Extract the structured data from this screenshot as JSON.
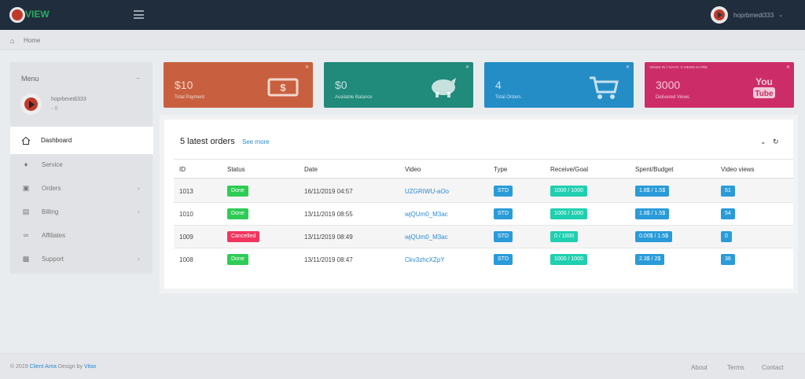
{
  "header": {
    "logo_text": "VIEW",
    "username": "hoprbmedi333"
  },
  "breadcrumb": {
    "home": "Home"
  },
  "sidebar": {
    "menu_label": "Menu",
    "username": "hoprbmedi333",
    "user_sub": "0",
    "items": [
      {
        "label": "Dashboard",
        "icon": "home-icon",
        "active": true
      },
      {
        "label": "Service",
        "icon": "tag-icon",
        "chevron": false
      },
      {
        "label": "Orders",
        "icon": "cart-icon",
        "chevron": true
      },
      {
        "label": "Billing",
        "icon": "card-icon",
        "chevron": true
      },
      {
        "label": "Affiliates",
        "icon": "link-icon",
        "chevron": false
      },
      {
        "label": "Support",
        "icon": "ticket-icon",
        "chevron": true
      }
    ]
  },
  "stats": [
    {
      "value": "$10",
      "caption": "Total Payment",
      "color": "#e8613a",
      "icon": "money-icon"
    },
    {
      "value": "$0",
      "caption": "Available Balance",
      "color": "#1e9a87",
      "icon": "piggy-bank-icon"
    },
    {
      "value": "4",
      "caption": "Total Orders",
      "color": "#2a9bd9",
      "icon": "cart-icon"
    },
    {
      "value": "3000",
      "caption": "Delivered Views",
      "top_caption": "VIEWS IN 7 DAYS: 0 VIEWS IN PRE",
      "color": "#e22f72",
      "icon": "youtube-icon"
    }
  ],
  "orders": {
    "title": "5 latest orders",
    "see_more": "See more",
    "columns": [
      "ID",
      "Status",
      "Date",
      "Video",
      "Type",
      "Receive/Goal",
      "Spent/Budget",
      "Video views"
    ],
    "rows": [
      {
        "id": "1013",
        "status": "Done",
        "status_color": "#2ecc55",
        "date": "16/11/2019 04:57",
        "video": "UZGRIWU-aOo",
        "type": "STD",
        "receive": "1000 / 1000",
        "spent": "1.8$ / 1.5$",
        "views": "51"
      },
      {
        "id": "1010",
        "status": "Done",
        "status_color": "#2ecc55",
        "date": "13/11/2019 08:55",
        "video": "wjQUm0_M3ac",
        "type": "STD",
        "receive": "1000 / 1000",
        "spent": "1.8$ / 1.5$",
        "views": "54"
      },
      {
        "id": "1009",
        "status": "Cancelled",
        "status_color": "#f0365f",
        "date": "13/11/2019 08:49",
        "video": "wjQUm0_M3ac",
        "type": "STD",
        "receive": "0 / 1000",
        "spent": "0.00$ / 1.5$",
        "views": "0"
      },
      {
        "id": "1008",
        "status": "Done",
        "status_color": "#2ecc55",
        "date": "13/11/2019 08:47",
        "video": "Ckv3zhcXZpY",
        "type": "STD",
        "receive": "1000 / 1000",
        "spent": "2.3$ / 2$",
        "views": "36"
      }
    ]
  },
  "footer": {
    "copy_prefix": "© 2019",
    "brand": "Client Area",
    "design_by": "Design by",
    "designer": "Vitax",
    "links": [
      "About",
      "Terms",
      "Contact"
    ]
  },
  "colors": {
    "type_badge": "#2a9bd9",
    "receive_badge": "#1fcfb0",
    "spent_badge": "#2a9bd9",
    "views_badge": "#2a9bd9"
  }
}
